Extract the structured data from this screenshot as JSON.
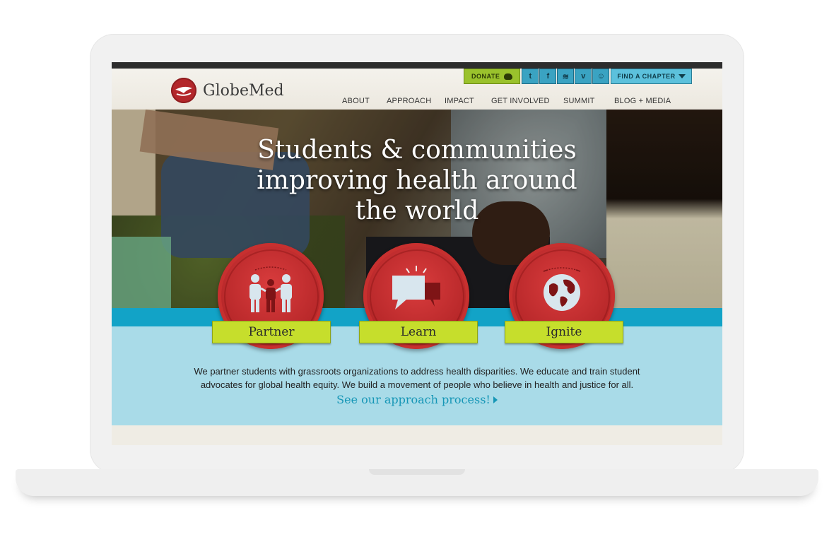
{
  "site": {
    "logo_text": "GlobeMed",
    "brand_red": "#b3272b",
    "accent_blue": "#12a3c7",
    "accent_green": "#c6de2c"
  },
  "utility": {
    "donate_label": "DONATE",
    "social_icons": [
      "twitter-icon",
      "facebook-icon",
      "rss-icon",
      "vimeo-icon",
      "social-icon"
    ],
    "social_glyphs": [
      "t",
      "f",
      "≋",
      "v",
      "☺"
    ],
    "find_chapter_label": "FIND A CHAPTER"
  },
  "nav": {
    "items": [
      {
        "label": "ABOUT"
      },
      {
        "label": "APPROACH"
      },
      {
        "label": "IMPACT"
      },
      {
        "label": "GET INVOLVED"
      },
      {
        "label": "SUMMIT"
      },
      {
        "label": "BLOG + MEDIA"
      }
    ]
  },
  "hero": {
    "headline_line1": "Students & communities",
    "headline_line2": "improving health around",
    "headline_line3": "the world"
  },
  "pillars": [
    {
      "label": "Partner",
      "icon": "people-icon"
    },
    {
      "label": "Learn",
      "icon": "speech-bubbles-icon"
    },
    {
      "label": "Ignite",
      "icon": "globe-icon"
    }
  ],
  "mission": {
    "line1": "We partner students with grassroots organizations to address health disparities. We educate and train student",
    "line2": "advocates for global health equity. We build a movement of people who believe in health and justice for all.",
    "cta": "See our approach process!"
  }
}
